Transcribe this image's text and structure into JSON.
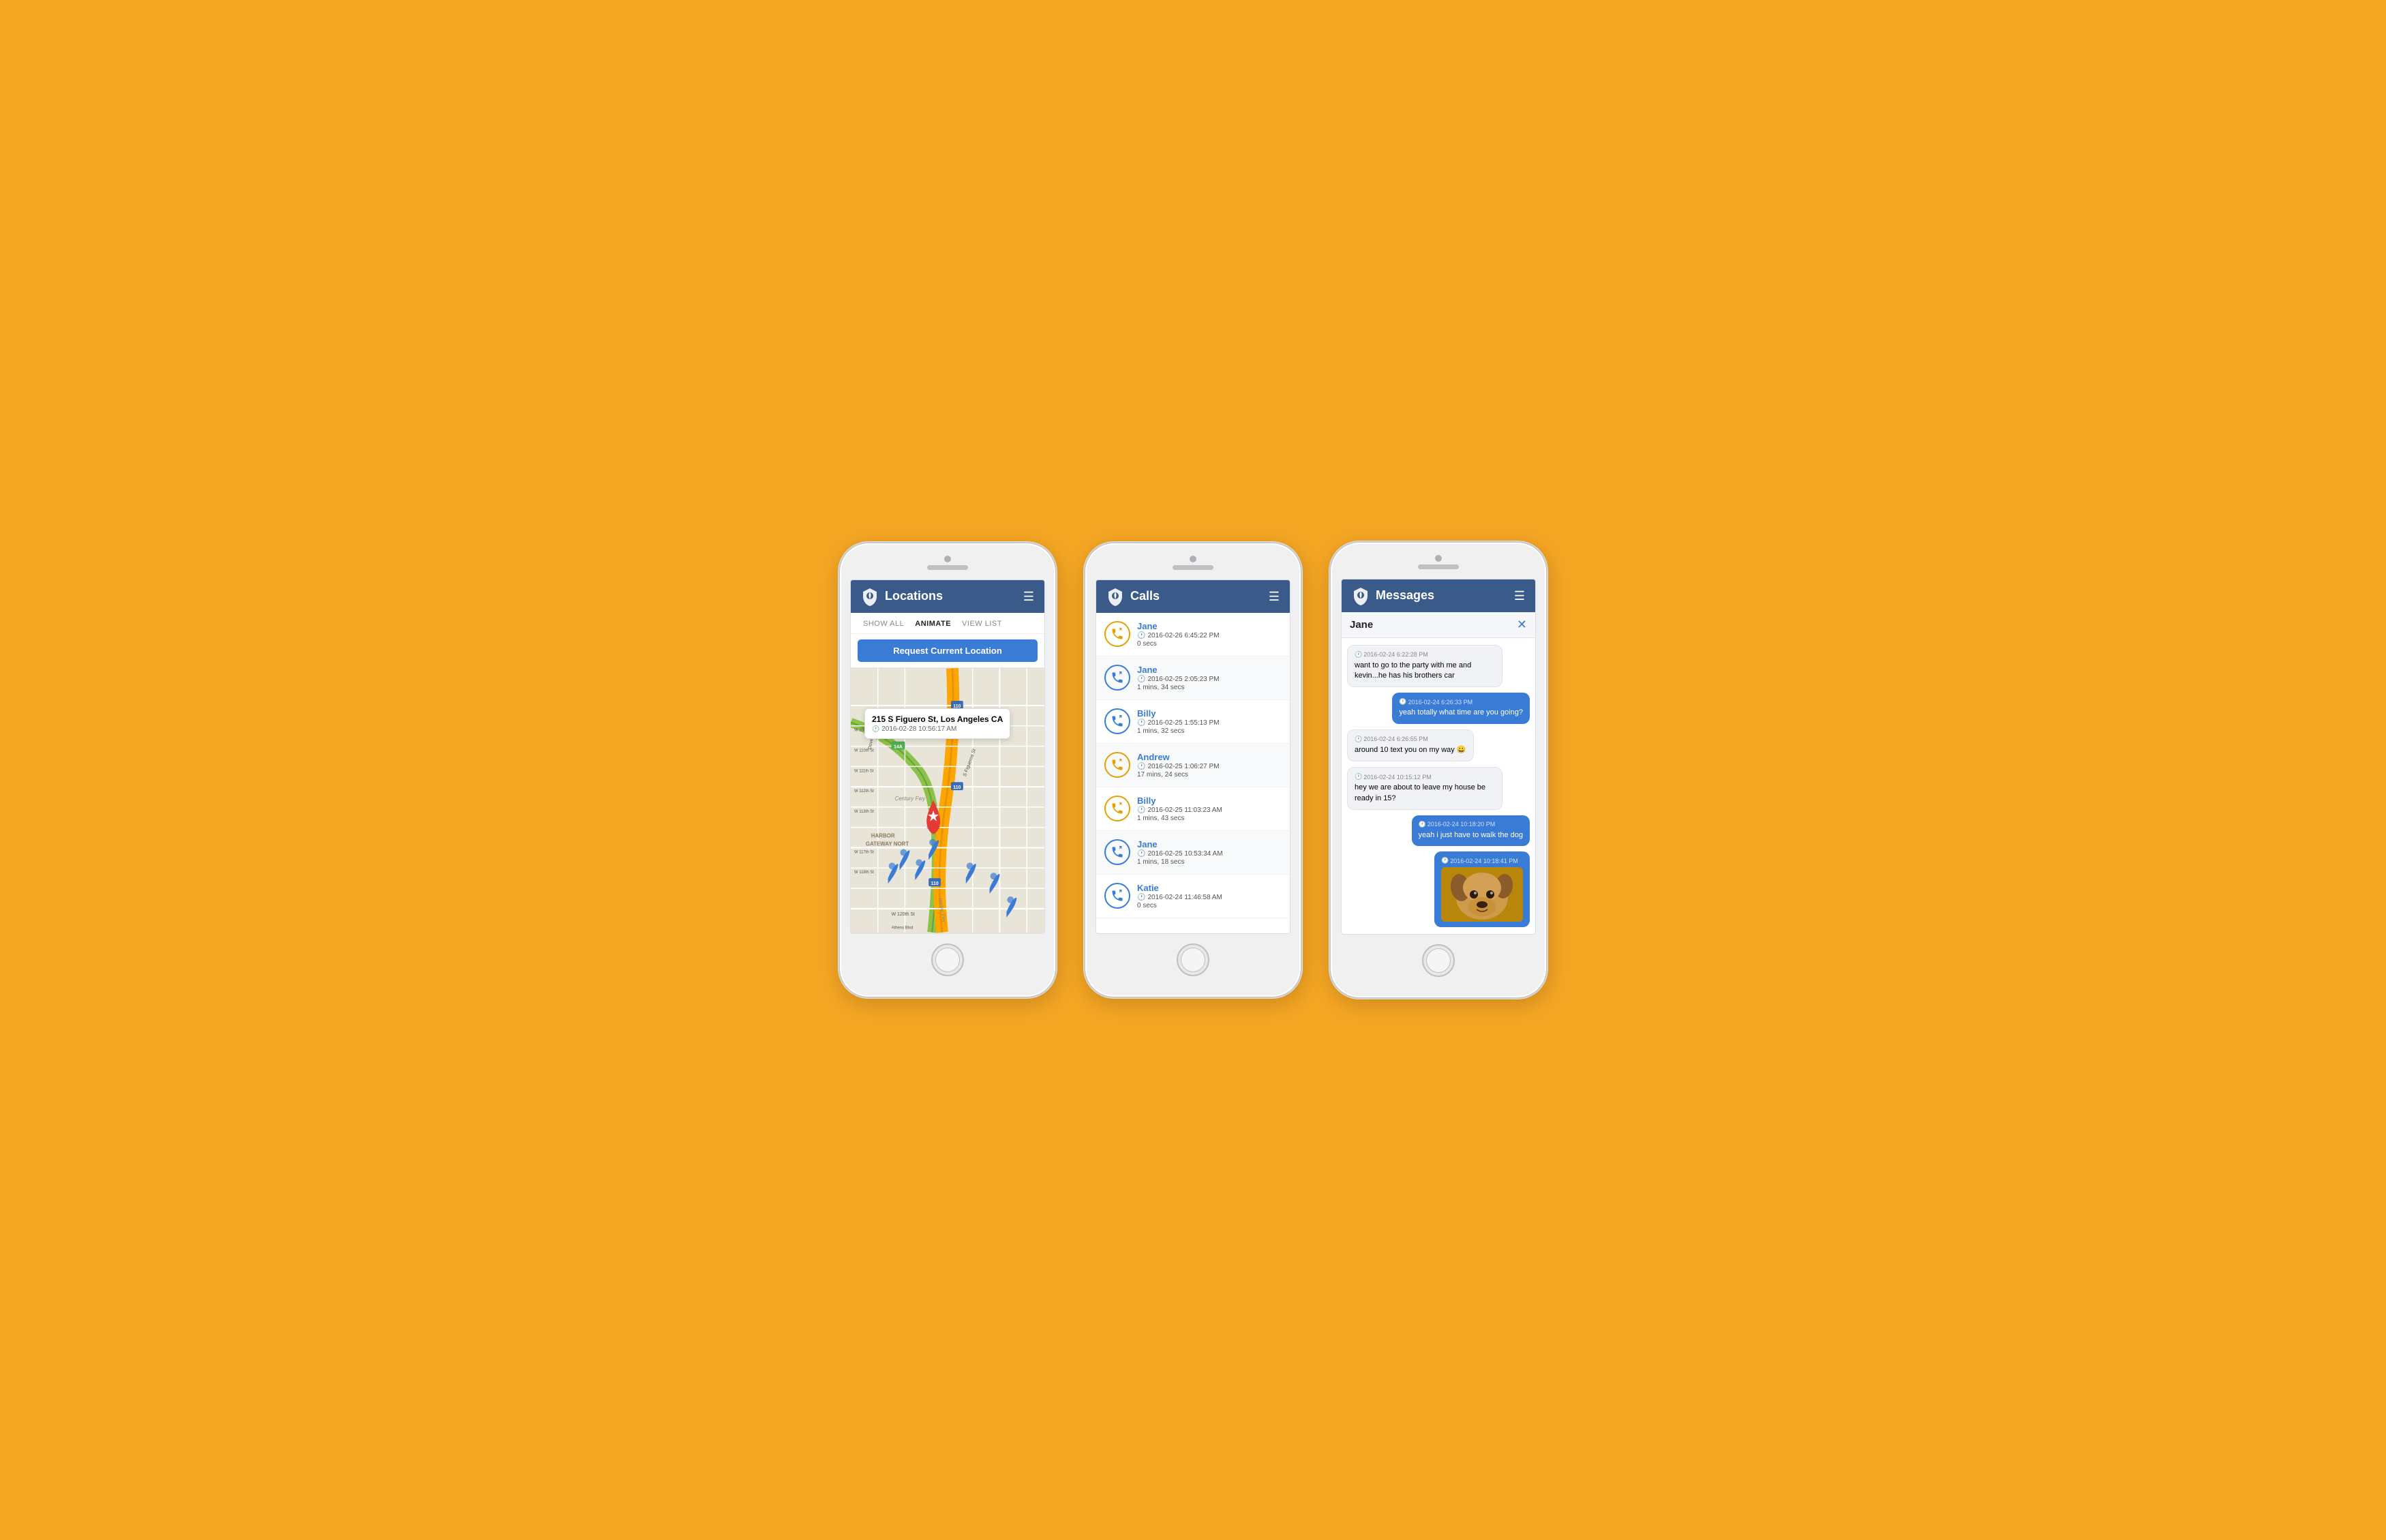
{
  "colors": {
    "background": "#F5A623",
    "header": "#3a5a8a",
    "accent_blue": "#3a7bd5",
    "accent_orange": "#E8A000",
    "text_light": "#ffffff"
  },
  "phone1": {
    "title": "Locations",
    "controls": [
      {
        "label": "SHOW ALL",
        "active": false
      },
      {
        "label": "ANIMATE",
        "active": true
      },
      {
        "label": "VIEW LIST",
        "active": false
      }
    ],
    "request_btn": "Request Current Location",
    "popup": {
      "address": "215 S Figuero St, Los Angeles CA",
      "time": "2016-02-28 10:56:17 AM"
    }
  },
  "phone2": {
    "title": "Calls",
    "calls": [
      {
        "name": "Jane",
        "type": "outgoing",
        "time": "2016-02-26 6:45:22 PM",
        "duration": "0 secs"
      },
      {
        "name": "Jane",
        "type": "incoming",
        "time": "2016-02-25 2:05:23 PM",
        "duration": "1 mins, 34 secs"
      },
      {
        "name": "Billy",
        "type": "incoming",
        "time": "2016-02-25 1:55:13 PM",
        "duration": "1 mins, 32 secs"
      },
      {
        "name": "Andrew",
        "type": "outgoing",
        "time": "2016-02-25 1:06:27 PM",
        "duration": "17 mins, 24 secs"
      },
      {
        "name": "Billy",
        "type": "outgoing",
        "time": "2016-02-25 11:03:23 AM",
        "duration": "1 mins, 43 secs"
      },
      {
        "name": "Jane",
        "type": "incoming",
        "time": "2016-02-25 10:53:34 AM",
        "duration": "1 mins, 18 secs"
      },
      {
        "name": "Katie",
        "type": "incoming",
        "time": "2016-02-24 11:46:58 AM",
        "duration": "0 secs"
      }
    ]
  },
  "phone3": {
    "title": "Messages",
    "contact": "Jane",
    "messages": [
      {
        "side": "received",
        "time": "2016-02-24 6:22:28 PM",
        "text": "want to go to the party with me and kevin...he has his brothers car"
      },
      {
        "side": "sent",
        "time": "2016-02-24 6:26:33 PM",
        "text": "yeah totally what time are you going?"
      },
      {
        "side": "received",
        "time": "2016-02-24 6:26:55 PM",
        "text": "around 10 text you on my way 😀"
      },
      {
        "side": "received",
        "time": "2016-02-24 10:15:12 PM",
        "text": "hey we are about to leave my house be ready in 15?"
      },
      {
        "side": "sent",
        "time": "2016-02-24 10:18:20 PM",
        "text": "yeah i just have to walk the dog"
      },
      {
        "side": "sent",
        "time": "2016-02-24 10:18:41 PM",
        "text": "",
        "has_image": true
      }
    ]
  }
}
